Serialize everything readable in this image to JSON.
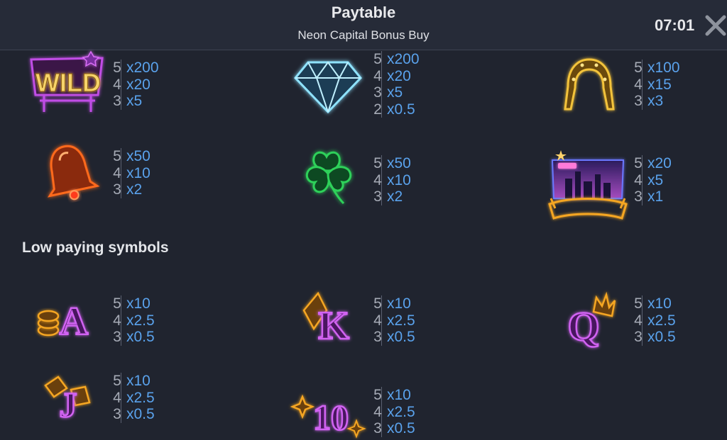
{
  "header": {
    "title": "Paytable",
    "subtitle": "Neon Capital Bonus Buy",
    "clock": "07:01"
  },
  "sections": {
    "low_paying": "Low paying symbols"
  },
  "symbols": {
    "wild": {
      "text": "WILD",
      "rows": [
        {
          "count": "5",
          "mult": "x200"
        },
        {
          "count": "4",
          "mult": "x20"
        },
        {
          "count": "3",
          "mult": "x5"
        }
      ]
    },
    "diamond": {
      "rows": [
        {
          "count": "5",
          "mult": "x200"
        },
        {
          "count": "4",
          "mult": "x20"
        },
        {
          "count": "3",
          "mult": "x5"
        },
        {
          "count": "2",
          "mult": "x0.5"
        }
      ]
    },
    "horseshoe": {
      "rows": [
        {
          "count": "5",
          "mult": "x100"
        },
        {
          "count": "4",
          "mult": "x15"
        },
        {
          "count": "3",
          "mult": "x3"
        }
      ]
    },
    "bell": {
      "rows": [
        {
          "count": "5",
          "mult": "x50"
        },
        {
          "count": "4",
          "mult": "x10"
        },
        {
          "count": "3",
          "mult": "x2"
        }
      ]
    },
    "clover": {
      "rows": [
        {
          "count": "5",
          "mult": "x50"
        },
        {
          "count": "4",
          "mult": "x10"
        },
        {
          "count": "3",
          "mult": "x2"
        }
      ]
    },
    "city": {
      "rows": [
        {
          "count": "5",
          "mult": "x20"
        },
        {
          "count": "4",
          "mult": "x5"
        },
        {
          "count": "3",
          "mult": "x1"
        }
      ]
    },
    "ace": {
      "letter": "A",
      "rows": [
        {
          "count": "5",
          "mult": "x10"
        },
        {
          "count": "4",
          "mult": "x2.5"
        },
        {
          "count": "3",
          "mult": "x0.5"
        }
      ]
    },
    "king": {
      "letter": "K",
      "rows": [
        {
          "count": "5",
          "mult": "x10"
        },
        {
          "count": "4",
          "mult": "x2.5"
        },
        {
          "count": "3",
          "mult": "x0.5"
        }
      ]
    },
    "queen": {
      "letter": "Q",
      "rows": [
        {
          "count": "5",
          "mult": "x10"
        },
        {
          "count": "4",
          "mult": "x2.5"
        },
        {
          "count": "3",
          "mult": "x0.5"
        }
      ]
    },
    "jack": {
      "letter": "J",
      "rows": [
        {
          "count": "5",
          "mult": "x10"
        },
        {
          "count": "4",
          "mult": "x2.5"
        },
        {
          "count": "3",
          "mult": "x0.5"
        }
      ]
    },
    "ten": {
      "letter": "10",
      "rows": [
        {
          "count": "5",
          "mult": "x10"
        },
        {
          "count": "4",
          "mult": "x2.5"
        },
        {
          "count": "3",
          "mult": "x0.5"
        }
      ]
    }
  },
  "icons": {
    "close": "close-icon",
    "wild": "wild-symbol-icon",
    "diamond": "diamond-icon",
    "horseshoe": "horseshoe-icon",
    "bell": "bell-icon",
    "clover": "clover-icon",
    "city": "city-skyline-icon",
    "ace": "ace-card-icon",
    "king": "king-card-icon",
    "queen": "queen-card-icon",
    "jack": "jack-card-icon",
    "ten": "ten-card-icon"
  },
  "colors": {
    "background": "#20242f",
    "header": "#262b38",
    "multiplier": "#5aa2ec",
    "count": "#a6abb6",
    "neon_purple": "#c14ee6",
    "neon_orange": "#f5a623",
    "neon_gold": "#e6b423",
    "neon_red": "#ff5a1a",
    "neon_green": "#2fd15a",
    "neon_blue": "#8fe3ff"
  }
}
